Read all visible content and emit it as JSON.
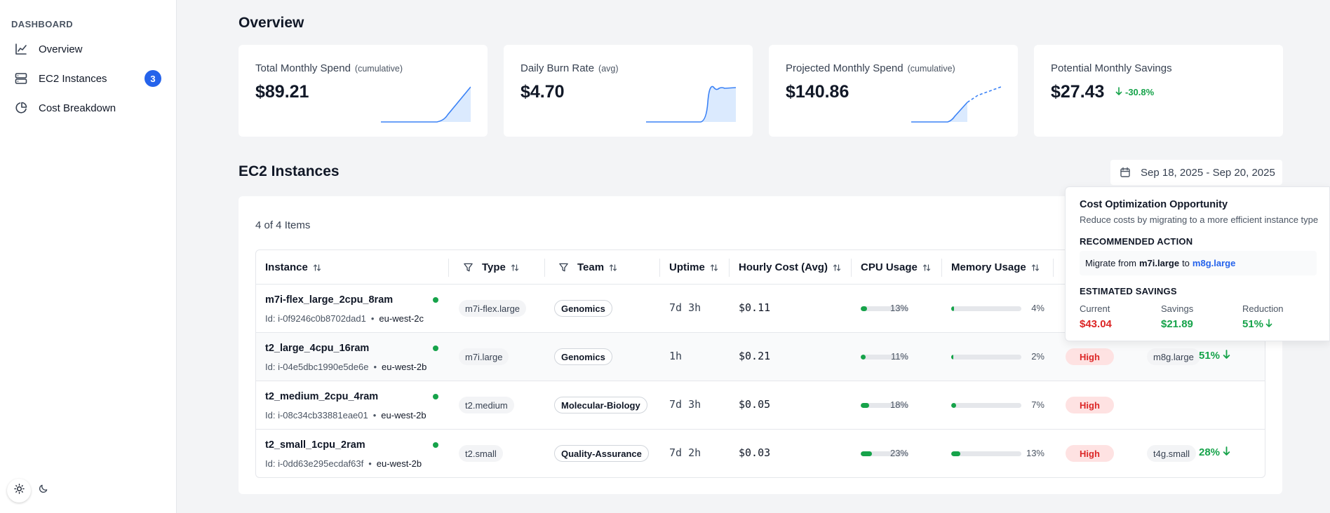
{
  "sidebar": {
    "heading": "DASHBOARD",
    "items": [
      {
        "label": "Overview",
        "icon": "line-chart-icon"
      },
      {
        "label": "EC2 Instances",
        "icon": "server-icon",
        "badge": "3"
      },
      {
        "label": "Cost Breakdown",
        "icon": "pie-chart-icon"
      }
    ],
    "theme": {
      "light_icon": "sun-icon",
      "dark_icon": "moon-icon",
      "active": "light"
    }
  },
  "overview": {
    "title": "Overview",
    "cards": [
      {
        "label": "Total Monthly Spend",
        "sub": "(cumulative)",
        "value": "$89.21"
      },
      {
        "label": "Daily Burn Rate",
        "sub": "(avg)",
        "value": "$4.70"
      },
      {
        "label": "Projected Monthly Spend",
        "sub": "(cumulative)",
        "value": "$140.86"
      },
      {
        "label": "Potential Monthly Savings",
        "sub": "",
        "value": "$27.43",
        "change": "-30.8%"
      }
    ]
  },
  "ec2": {
    "title": "EC2 Instances",
    "date_range": "Sep 18, 2025 - Sep 20, 2025",
    "items_count": "4 of 4 Items",
    "columns": [
      "Instance",
      "Type",
      "Team",
      "Uptime",
      "Hourly Cost (Avg)",
      "CPU Usage",
      "Memory Usage"
    ],
    "rows": [
      {
        "name": "m7i-flex_large_2cpu_8ram",
        "id": "Id: i-0f9246c0b8702dad1",
        "region": "eu-west-2c",
        "type": "m7i-flex.large",
        "team": "Genomics",
        "uptime": "7d 3h",
        "cost": "$0.11",
        "cpu": 13,
        "cpu_label": "13%",
        "mem": 4,
        "mem_label": "4%",
        "rec": "",
        "suggest": "",
        "savings": ""
      },
      {
        "name": "t2_large_4cpu_16ram",
        "id": "Id: i-04e5dbc1990e5de6e",
        "region": "eu-west-2b",
        "type": "m7i.large",
        "team": "Genomics",
        "uptime": "1h",
        "cost": "$0.21",
        "cpu": 11,
        "cpu_label": "11%",
        "mem": 2,
        "mem_label": "2%",
        "rec": "High",
        "suggest": "m8g.large",
        "savings": "51%"
      },
      {
        "name": "t2_medium_2cpu_4ram",
        "id": "Id: i-08c34cb33881eae01",
        "region": "eu-west-2b",
        "type": "t2.medium",
        "team": "Molecular-Biology",
        "uptime": "7d 3h",
        "cost": "$0.05",
        "cpu": 18,
        "cpu_label": "18%",
        "mem": 7,
        "mem_label": "7%",
        "rec": "High",
        "suggest": "",
        "savings": ""
      },
      {
        "name": "t2_small_1cpu_2ram",
        "id": "Id: i-0dd63e295ecdaf63f",
        "region": "eu-west-2b",
        "type": "t2.small",
        "team": "Quality-Assurance",
        "uptime": "7d 2h",
        "cost": "$0.03",
        "cpu": 23,
        "cpu_label": "23%",
        "mem": 13,
        "mem_label": "13%",
        "rec": "High",
        "suggest": "t4g.small",
        "savings": "28%"
      }
    ]
  },
  "popover": {
    "title": "Cost Optimization Opportunity",
    "desc": "Reduce costs by migrating to a more efficient instance type",
    "rec_heading": "RECOMMENDED ACTION",
    "migrate_prefix": "Migrate from",
    "from": "m7i.large",
    "to_word": "to",
    "to": "m8g.large",
    "est_heading": "ESTIMATED SAVINGS",
    "current_label": "Current",
    "current_value": "$43.04",
    "savings_label": "Savings",
    "savings_value": "$21.89",
    "reduction_label": "Reduction",
    "reduction_value": "51%"
  },
  "colors": {
    "accent": "#2563eb",
    "positive": "#16a34a",
    "negative": "#dc2626",
    "sparkline": "#3b82f6",
    "sparkline_fill": "#dbeafe"
  }
}
